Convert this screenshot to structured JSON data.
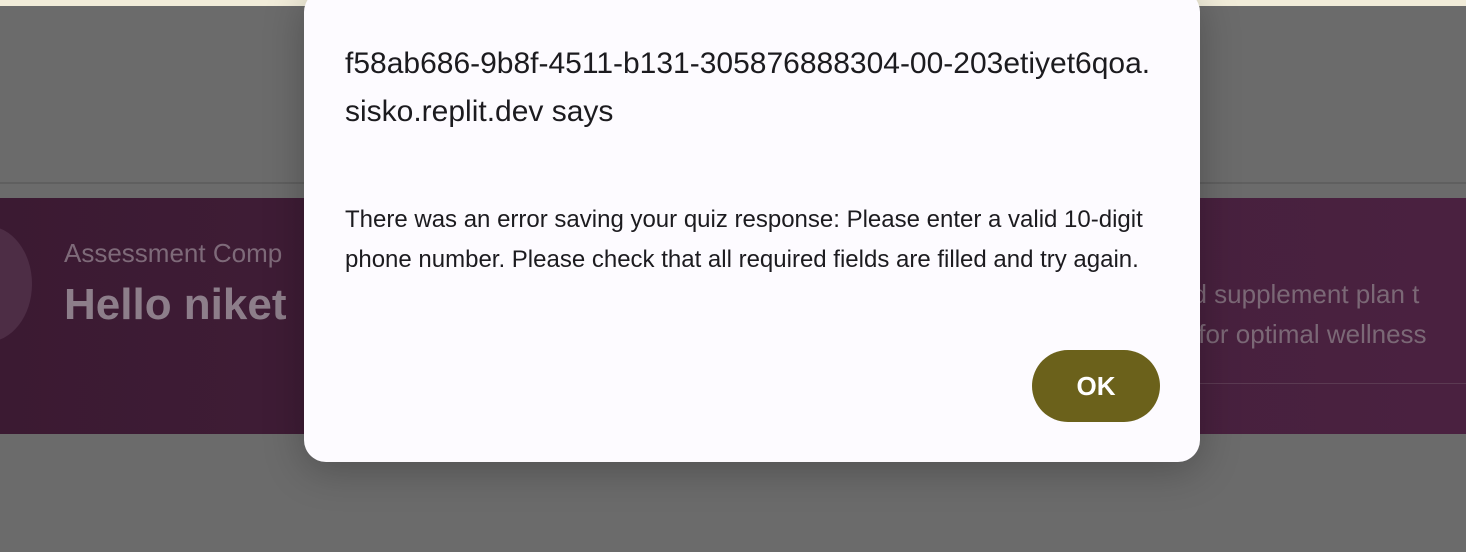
{
  "background": {
    "hero_subtitle": "Assessment Comp",
    "hero_title": "Hello niket",
    "hero_right_line1": "ed supplement plan t",
    "hero_right_line2": "s for optimal wellness"
  },
  "dialog": {
    "title": "f58ab686-9b8f-4511-b131-305876888304-00-203etiyet6qoa.sisko.replit.dev says",
    "message": "There was an error saving your quiz response: Please enter a valid 10-digit phone number. Please check that all required fields are filled and try again.",
    "ok_label": "OK"
  },
  "colors": {
    "overlay": "#6b6b6b",
    "hero_background": "#3b1a32",
    "dialog_background": "#fdfbff",
    "ok_button": "#6b611b"
  }
}
